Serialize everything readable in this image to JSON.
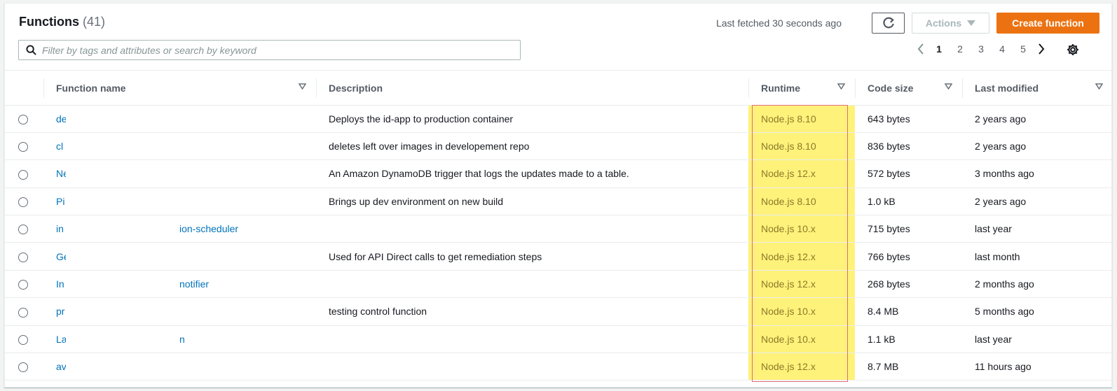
{
  "header": {
    "title": "Functions",
    "count": "(41)",
    "last_fetched": "Last fetched 30 seconds ago",
    "actions_label": "Actions",
    "create_label": "Create function",
    "search_placeholder": "Filter by tags and attributes or search by keyword"
  },
  "pagination": {
    "pages": [
      "1",
      "2",
      "3",
      "4",
      "5"
    ],
    "current": "1"
  },
  "table": {
    "columns": [
      "Function name",
      "Description",
      "Runtime",
      "Code size",
      "Last modified"
    ],
    "rows": [
      {
        "name": "de",
        "name_tail": "",
        "description": "Deploys the id-app to production container",
        "runtime": "Node.js 8.10",
        "size": "643 bytes",
        "modified": "2 years ago"
      },
      {
        "name": "cl",
        "name_tail": "",
        "description": "deletes left over images in developement repo",
        "runtime": "Node.js 8.10",
        "size": "836 bytes",
        "modified": "2 years ago"
      },
      {
        "name": "Ne",
        "name_tail": "",
        "description": "An Amazon DynamoDB trigger that logs the updates made to a table.",
        "runtime": "Node.js 12.x",
        "size": "572 bytes",
        "modified": "3 months ago"
      },
      {
        "name": "Pi",
        "name_tail": "",
        "description": "Brings up dev environment on new build",
        "runtime": "Node.js 8.10",
        "size": "1.0 kB",
        "modified": "2 years ago"
      },
      {
        "name": "in",
        "name_tail": "ion-scheduler",
        "description": "",
        "runtime": "Node.js 10.x",
        "size": "715 bytes",
        "modified": "last year"
      },
      {
        "name": "Ge",
        "name_tail": "",
        "description": "Used for API Direct calls to get remediation steps",
        "runtime": "Node.js 12.x",
        "size": "766 bytes",
        "modified": "last month"
      },
      {
        "name": "In",
        "name_tail": "notifier",
        "description": "",
        "runtime": "Node.js 12.x",
        "size": "268 bytes",
        "modified": "2 months ago"
      },
      {
        "name": "pr",
        "name_tail": "",
        "description": "testing control function",
        "runtime": "Node.js 10.x",
        "size": "8.4 MB",
        "modified": "5 months ago"
      },
      {
        "name": "La",
        "name_tail": "n",
        "description": "",
        "runtime": "Node.js 10.x",
        "size": "1.1 kB",
        "modified": "last year"
      },
      {
        "name": "av",
        "name_tail": "",
        "description": "",
        "runtime": "Node.js 12.x",
        "size": "8.7 MB",
        "modified": "11 hours ago"
      }
    ]
  },
  "colors": {
    "accent": "#ec7211",
    "link": "#0073bb",
    "highlight": "#fff27a",
    "highlight_border": "#e06c78"
  }
}
